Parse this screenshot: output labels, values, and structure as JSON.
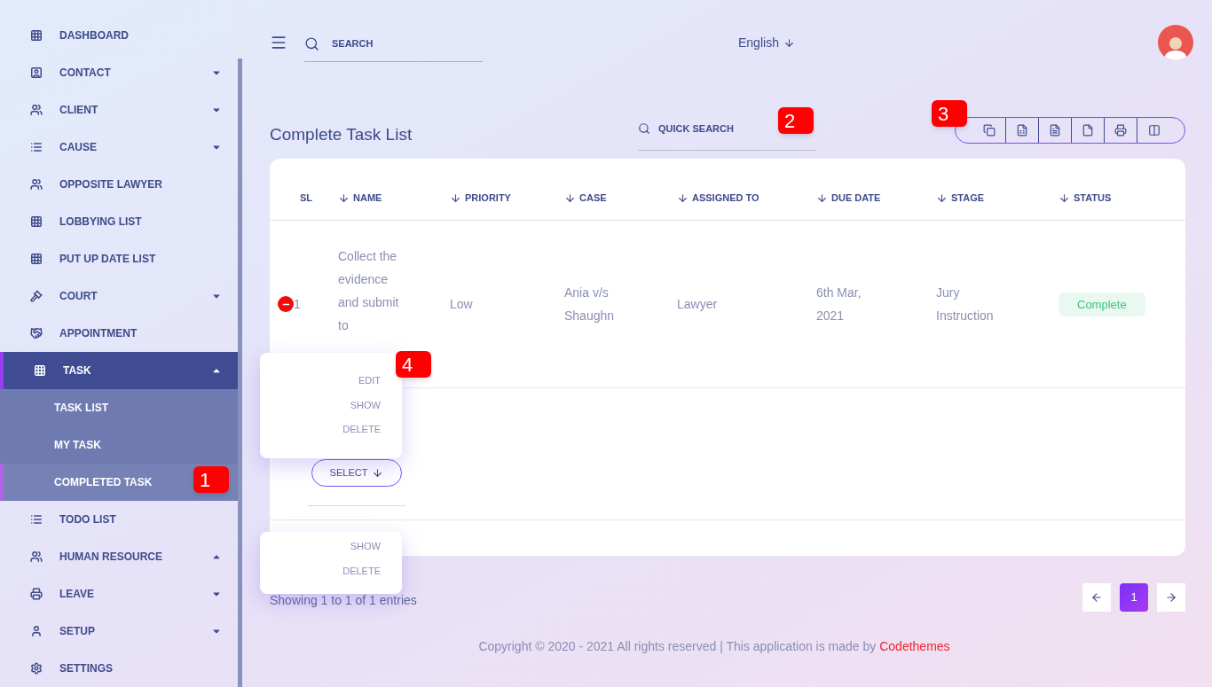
{
  "sidebar": {
    "items": [
      {
        "label": "DASHBOARD",
        "kind": "link",
        "selected": false
      },
      {
        "label": "CONTACT",
        "kind": "group",
        "expanded": false,
        "selected": false
      },
      {
        "label": "CLIENT",
        "kind": "group",
        "expanded": false,
        "selected": false
      },
      {
        "label": "CAUSE",
        "kind": "group",
        "expanded": false,
        "selected": false
      },
      {
        "label": "OPPOSITE LAWYER",
        "kind": "link",
        "selected": false
      },
      {
        "label": "LOBBYING LIST",
        "kind": "link",
        "selected": false
      },
      {
        "label": "PUT UP DATE LIST",
        "kind": "link",
        "selected": false
      },
      {
        "label": "COURT",
        "kind": "group",
        "expanded": false,
        "selected": false
      },
      {
        "label": "APPOINTMENT",
        "kind": "link",
        "selected": false
      },
      {
        "label": "TASK",
        "kind": "group",
        "expanded": true,
        "selected": true,
        "children": [
          {
            "label": "TASK LIST",
            "selected": false
          },
          {
            "label": "MY TASK",
            "selected": false
          },
          {
            "label": "COMPLETED TASK",
            "selected": true
          }
        ]
      },
      {
        "label": "TODO LIST",
        "kind": "link",
        "selected": false
      },
      {
        "label": "HUMAN RESOURCE",
        "kind": "group",
        "expanded": true,
        "selected": false
      },
      {
        "label": "LEAVE",
        "kind": "group",
        "expanded": false,
        "selected": false
      },
      {
        "label": "SETUP",
        "kind": "group",
        "expanded": false,
        "selected": false
      },
      {
        "label": "SETTINGS",
        "kind": "link",
        "selected": false
      }
    ]
  },
  "topbar": {
    "search_placeholder": "SEARCH",
    "language": "English"
  },
  "page": {
    "title": "Complete Task List",
    "quick_search_placeholder": "QUICK SEARCH"
  },
  "table": {
    "columns": [
      {
        "label": "SL",
        "sortable": false
      },
      {
        "label": "NAME",
        "sortable": true
      },
      {
        "label": "PRIORITY",
        "sortable": true
      },
      {
        "label": "CASE",
        "sortable": true
      },
      {
        "label": "ASSIGNED TO",
        "sortable": true
      },
      {
        "label": "DUE DATE",
        "sortable": true
      },
      {
        "label": "STAGE",
        "sortable": true
      },
      {
        "label": "STATUS",
        "sortable": true
      }
    ],
    "rows": [
      {
        "sl": "1",
        "name": "Collect the evidence and submit to",
        "priority": "Low",
        "case": "Ania v/s Shaughn",
        "assigned_to": "Lawyer",
        "due_date": "6th Mar, 2021",
        "stage": "Jury Instruction",
        "status": "Complete",
        "expanded": true
      }
    ]
  },
  "row_actions": {
    "select_label": "SELECT",
    "menus": [
      {
        "items": [
          "EDIT",
          "SHOW",
          "DELETE"
        ]
      },
      {
        "items": [
          "SHOW",
          "DELETE"
        ]
      }
    ]
  },
  "info": "Showing 1 to 1 of 1 entries",
  "pagination": {
    "pages": [
      {
        "label": "1",
        "selected": true
      }
    ]
  },
  "footer": {
    "text": "Copyright © 2020 - 2021 All rights reserved | This application is made by ",
    "link": "Codethemes"
  },
  "annotations": [
    "1",
    "2",
    "3",
    "4"
  ]
}
